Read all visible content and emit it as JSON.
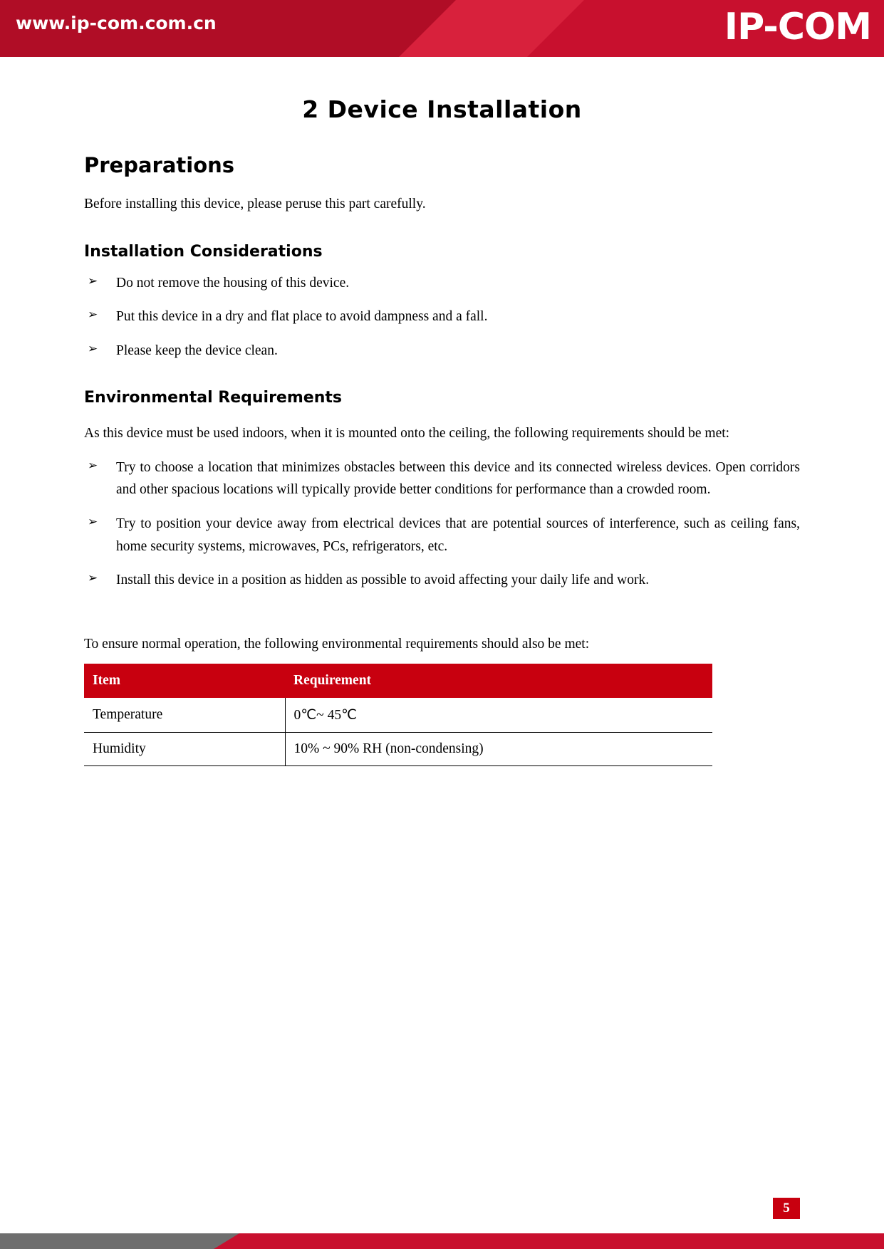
{
  "header": {
    "site_url": "www.ip-com.com.cn",
    "brand": "IP-COM"
  },
  "document": {
    "chapter_title": "2 Device Installation",
    "section_title": "Preparations",
    "intro_text": "Before installing this device, please peruse this part carefully.",
    "subsection_1": {
      "title": "Installation Considerations",
      "bullets": [
        "Do not remove the housing of this device.",
        "Put this device in a dry and flat place to avoid dampness and a fall.",
        "Please keep the device clean."
      ]
    },
    "subsection_2": {
      "title": "Environmental Requirements",
      "intro": "As this device must be used indoors, when it is mounted onto the ceiling, the following requirements should be met:",
      "bullets": [
        "Try to choose a location that minimizes obstacles between this device and its connected wireless devices. Open corridors and other spacious locations will typically provide better conditions for performance than a crowded room.",
        "Try to position your device away from electrical devices that are potential sources of interference, such as ceiling fans, home security systems, microwaves, PCs, refrigerators, etc.",
        "Install this device in a position as hidden as possible to avoid affecting your daily life and work."
      ],
      "table_intro": "To ensure normal operation, the following environmental requirements should also be met:",
      "table": {
        "headers": [
          "Item",
          "Requirement"
        ],
        "rows": [
          [
            "Temperature",
            "0℃~ 45℃"
          ],
          [
            "Humidity",
            "10% ~ 90% RH (non-condensing)"
          ]
        ]
      }
    }
  },
  "footer": {
    "page_number": "5"
  },
  "colors": {
    "brand_red": "#c8102e",
    "table_header_red": "#c8000f",
    "footer_grey": "#6e6e6e"
  },
  "icons": {
    "bullet_arrow": "➢"
  }
}
